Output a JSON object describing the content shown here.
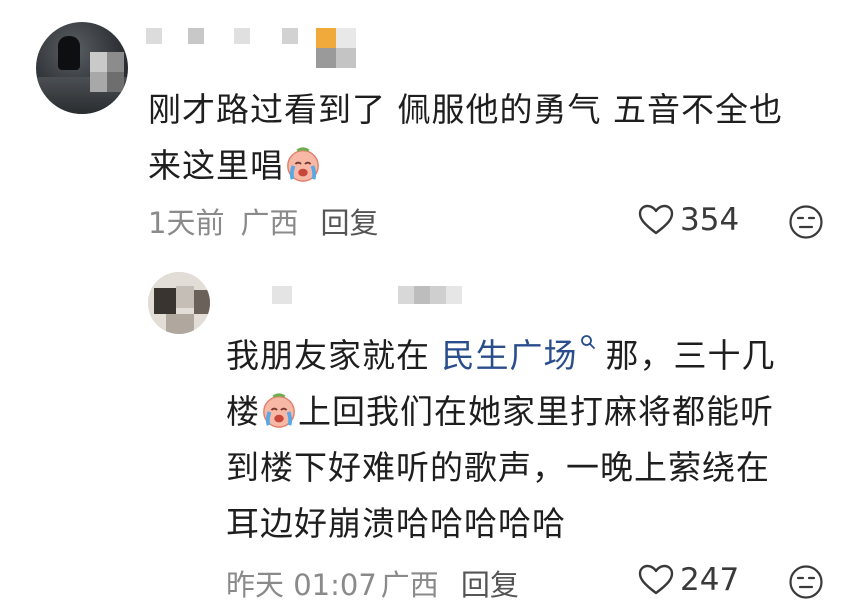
{
  "comment": {
    "text_line1": "刚才路过看到了  佩服他的勇气  五音不全也",
    "text_line2": "来这里唱",
    "time": "1天前",
    "location": "广西",
    "reply_label": "回复",
    "likes": "354",
    "username_blurred": true
  },
  "reply": {
    "text_before_link": "我朋友家就在 ",
    "link_text": "民生广场",
    "link_icon": "search-icon",
    "text_after_link_line1": "那，三十几",
    "text_line2_start": "楼",
    "text_line2_end": "上回我们在她家里打麻将都能听",
    "text_line3": "到楼下好难听的歌声，一晚上萦绕在",
    "text_line4": "耳边好崩溃哈哈哈哈哈",
    "time": "昨天 01:07",
    "location": "广西",
    "reply_label": "回复",
    "likes": "247",
    "username_blurred": true
  },
  "colors": {
    "link": "#2a4e8c",
    "meta": "#8a8a8a",
    "text": "#1e1e1e"
  }
}
